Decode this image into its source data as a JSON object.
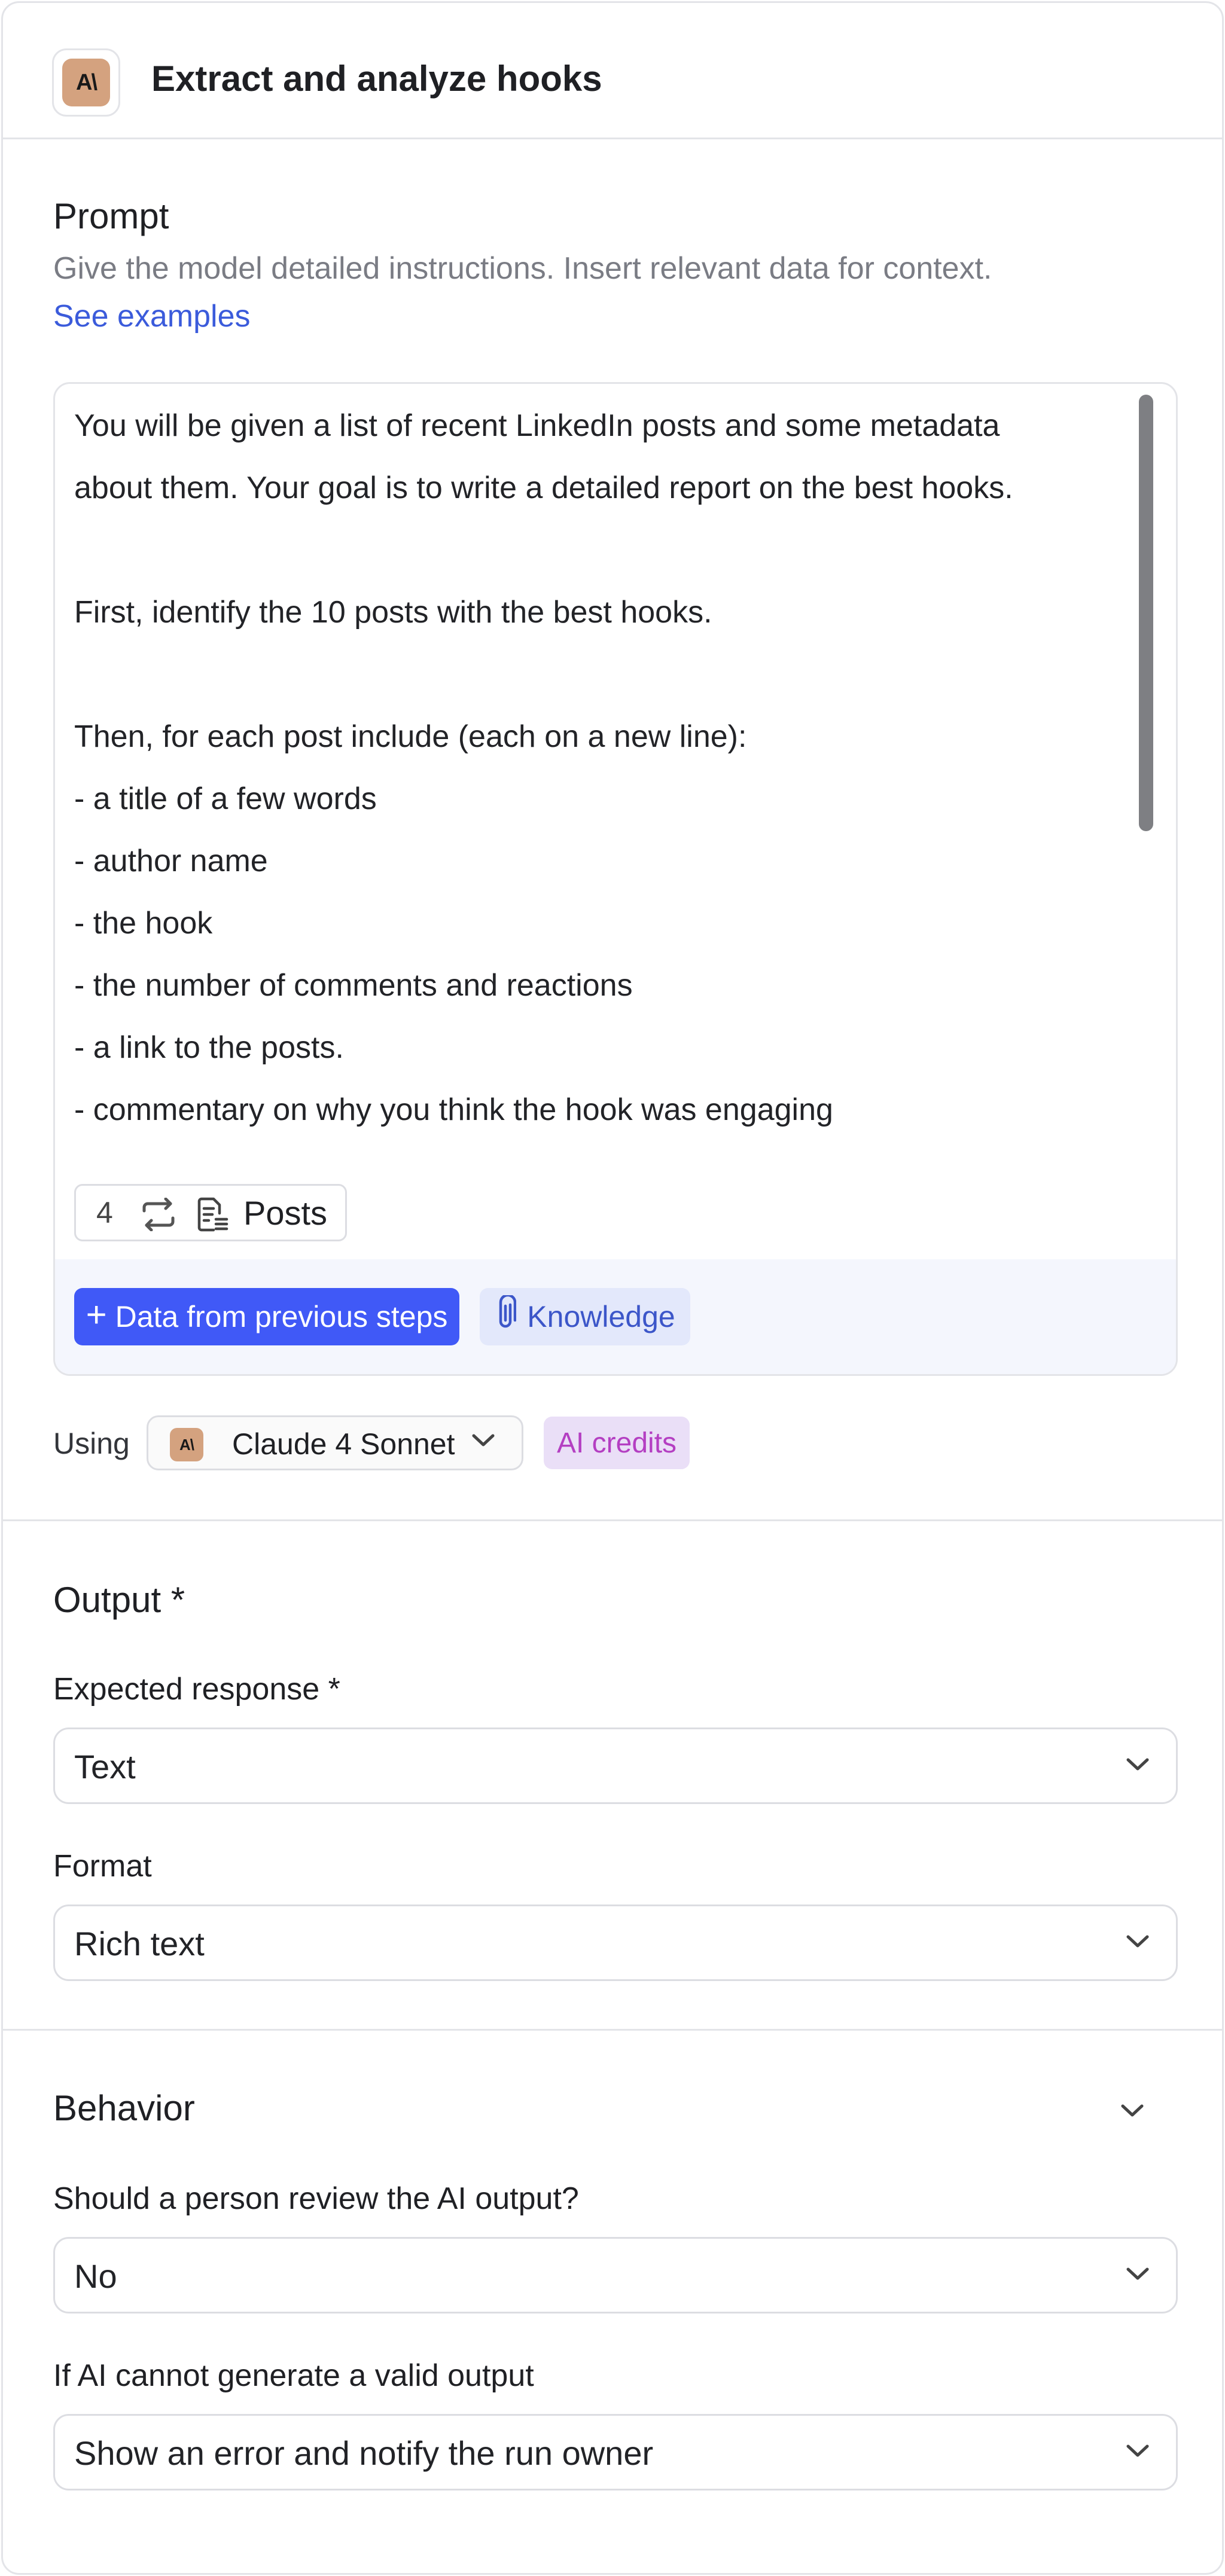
{
  "header": {
    "icon_text": "A\\",
    "title": "Extract and analyze hooks"
  },
  "prompt": {
    "title": "Prompt",
    "description": "Give the model detailed instructions. Insert relevant data for context.",
    "examples_link": "See examples",
    "lines": [
      "You will be given a list of recent LinkedIn posts and some metadata",
      "about them. Your goal is to write a detailed report on the best hooks.",
      "",
      "First, identify the 10 posts with the best hooks.",
      "",
      "Then, for each post include (each on a new line):",
      "- a title of a few words",
      "- author name",
      "- the hook",
      "- the number of comments and reactions",
      "- a link to the posts.",
      "- commentary on why you think the hook was engaging"
    ],
    "chip": {
      "step_number": "4",
      "label": "Posts"
    },
    "data_button": "Data from previous steps",
    "knowledge_button": "Knowledge"
  },
  "model": {
    "using_label": "Using",
    "logo_text": "A\\",
    "name": "Claude 4 Sonnet",
    "credits_badge": "AI credits"
  },
  "output": {
    "title": "Output *",
    "expected_label": "Expected response *",
    "expected_value": "Text",
    "format_label": "Format",
    "format_value": "Rich text"
  },
  "behavior": {
    "title": "Behavior",
    "review_label": "Should a person review the AI output?",
    "review_value": "No",
    "fallback_label": "If AI cannot generate a valid output",
    "fallback_value": "Show an error and notify the run owner"
  },
  "colors": {
    "primary_button": "#4059f7",
    "knowledge_bg": "#e3e8fb",
    "credits_bg": "#eadff7",
    "credits_text": "#b43fc2",
    "claude_brand": "#d4a27f",
    "link": "#3b5bdb"
  },
  "icons": {
    "loop": "repeat-arrows-icon",
    "document": "document-list-icon",
    "paperclip": "paperclip-icon",
    "chevron": "chevron-down-icon"
  }
}
